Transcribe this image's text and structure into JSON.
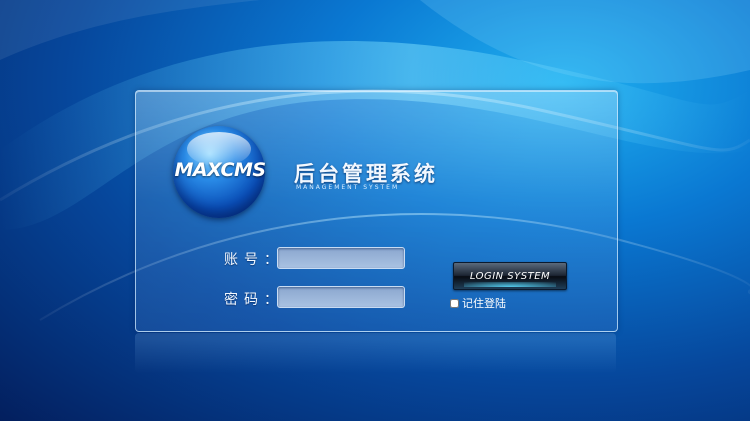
{
  "logo": {
    "text": "MAXCMS"
  },
  "system": {
    "title": "后台管理系统",
    "subtitle": "MANAGEMENT SYSTEM"
  },
  "form": {
    "account_label": "账号：",
    "password_label": "密码：",
    "account_value": "",
    "password_value": "",
    "login_button": "LOGIN SYSTEM",
    "remember_label": "记住登陆",
    "remember_checked": false
  }
}
